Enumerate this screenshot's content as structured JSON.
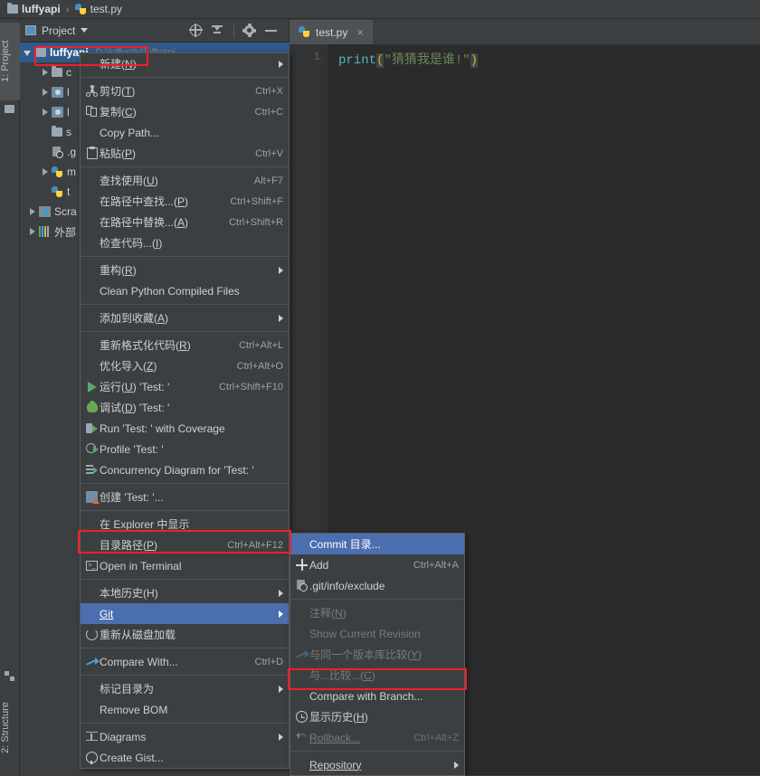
{
  "breadcrumb": {
    "project": "luffyapi",
    "separator": "›",
    "file": "test.py"
  },
  "left_strip": {
    "project_tab": "1: Project",
    "structure_tab": "2: Structure"
  },
  "project_panel": {
    "title": "Project",
    "tools": [
      "locate-icon",
      "collapse-all-icon",
      "gear-icon",
      "hide-icon"
    ],
    "tree": [
      {
        "label": "luffyapi",
        "hint": "D:\\luffycity\\luffyapi",
        "selected": true,
        "expanded": true,
        "icon": "folder-icon"
      },
      {
        "label": "c",
        "icon": "folder-icon",
        "expanded": false
      },
      {
        "label": "l",
        "icon": "module-icon",
        "expanded": false
      },
      {
        "label": "l",
        "icon": "module-icon",
        "expanded": false
      },
      {
        "label": "s",
        "icon": "folder-icon"
      },
      {
        "label": ".g",
        "icon": "gitignore-icon"
      },
      {
        "label": "m",
        "icon": "python-file-icon",
        "expanded": false
      },
      {
        "label": "t",
        "icon": "python-file-icon"
      },
      {
        "label": "Scra",
        "icon": "scratches-icon",
        "expanded": false
      },
      {
        "label": "外部",
        "icon": "libraries-icon",
        "expanded": false
      }
    ]
  },
  "editor": {
    "tab": {
      "label": "test.py",
      "close": "×",
      "icon": "python-file-icon"
    },
    "line_number": "1",
    "code": {
      "fn": "print",
      "open_paren": "(",
      "string": "\"猜猜我是谁!\"",
      "close_paren": ")"
    }
  },
  "context_menu": {
    "items": [
      {
        "label": "新建",
        "mnemonic": "N",
        "icon": "",
        "accel": "",
        "submenu": true
      },
      {
        "separator": true
      },
      {
        "label": "剪切",
        "mnemonic": "T",
        "icon": "cut-icon",
        "accel": "Ctrl+X"
      },
      {
        "label": "复制",
        "mnemonic": "C",
        "icon": "copy-icon",
        "accel": "Ctrl+C"
      },
      {
        "label": "Copy Path...",
        "icon": "",
        "accel": ""
      },
      {
        "label": "粘贴",
        "mnemonic": "P",
        "icon": "paste-icon",
        "accel": "Ctrl+V"
      },
      {
        "separator": true
      },
      {
        "label": "查找使用",
        "mnemonic": "U",
        "icon": "",
        "accel": "Alt+F7"
      },
      {
        "label": "在路径中查找...",
        "mnemonic": "P",
        "icon": "",
        "accel": "Ctrl+Shift+F"
      },
      {
        "label": "在路径中替换...",
        "mnemonic": "A",
        "icon": "",
        "accel": "Ctrl+Shift+R"
      },
      {
        "label": "检查代码...",
        "mnemonic": "I",
        "icon": "",
        "accel": ""
      },
      {
        "separator": true
      },
      {
        "label": "重构",
        "mnemonic": "R",
        "icon": "",
        "accel": "",
        "submenu": true
      },
      {
        "label": "Clean Python Compiled Files",
        "icon": "",
        "accel": ""
      },
      {
        "separator": true
      },
      {
        "label": "添加到收藏",
        "mnemonic": "A",
        "icon": "",
        "accel": "",
        "submenu": true
      },
      {
        "separator": true
      },
      {
        "label": "重新格式化代码",
        "mnemonic": "R",
        "icon": "",
        "accel": "Ctrl+Alt+L"
      },
      {
        "label": "优化导入",
        "mnemonic": "Z",
        "icon": "",
        "accel": "Ctrl+Alt+O"
      },
      {
        "label": "运行",
        "mnemonic": "U",
        "suffix": " 'Test: '",
        "icon": "run-icon",
        "accel": "Ctrl+Shift+F10"
      },
      {
        "label": "调试",
        "mnemonic": "D",
        "suffix": " 'Test: '",
        "icon": "debug-icon",
        "accel": ""
      },
      {
        "label": "Run 'Test: ' with Coverage",
        "mnemonic": "",
        "icon": "coverage-icon",
        "accel": ""
      },
      {
        "label": "Profile 'Test: '",
        "icon": "profile-icon",
        "accel": ""
      },
      {
        "label": "Concurrency Diagram for 'Test: '",
        "icon": "concurrency-icon",
        "accel": ""
      },
      {
        "separator": true
      },
      {
        "label": "创建 'Test: '...",
        "icon": "create-config-icon",
        "accel": ""
      },
      {
        "separator": true
      },
      {
        "label": "在 Explorer 中显示",
        "icon": "",
        "accel": ""
      },
      {
        "label": "目录路径",
        "mnemonic": "P",
        "icon": "",
        "accel": "Ctrl+Alt+F12"
      },
      {
        "label": "Open in Terminal",
        "icon": "terminal-icon",
        "accel": ""
      },
      {
        "separator": true
      },
      {
        "label": "本地历史",
        "mnemonic": "H",
        "icon": "",
        "accel": "",
        "submenu": true
      },
      {
        "label": "Git",
        "mnemonic": "G",
        "icon": "",
        "accel": "",
        "submenu": true,
        "selected": true,
        "highlighted_box": true
      },
      {
        "label": "重新从磁盘加载",
        "icon": "reload-icon",
        "accel": ""
      },
      {
        "separator": true
      },
      {
        "label": "Compare With...",
        "icon": "compare-icon",
        "accel": "Ctrl+D"
      },
      {
        "separator": true
      },
      {
        "label": "标记目录为",
        "icon": "",
        "accel": "",
        "submenu": true
      },
      {
        "label": "Remove BOM",
        "icon": "",
        "accel": ""
      },
      {
        "separator": true
      },
      {
        "label": "Diagrams",
        "icon": "diagrams-icon",
        "accel": "",
        "submenu": true
      },
      {
        "label": "Create Gist...",
        "icon": "github-icon",
        "accel": ""
      }
    ]
  },
  "git_submenu": {
    "items": [
      {
        "label": "Commit 目录...",
        "mnemonic": "t",
        "icon": "",
        "accel": "",
        "selected": true
      },
      {
        "label": "Add",
        "icon": "plus-icon",
        "accel": "Ctrl+Alt+A"
      },
      {
        "label": ".git/info/exclude",
        "icon": "gitignore-icon",
        "accel": ""
      },
      {
        "separator": true
      },
      {
        "label": "注释",
        "mnemonic": "N",
        "icon": "",
        "accel": "",
        "disabled": true
      },
      {
        "label": "Show Current Revision",
        "icon": "",
        "accel": "",
        "disabled": true
      },
      {
        "label": "与同一个版本库比较",
        "mnemonic": "Y",
        "icon": "compare-icon",
        "accel": "",
        "disabled": true
      },
      {
        "label": "与...比较...",
        "mnemonic": "C",
        "icon": "",
        "accel": "",
        "disabled": true
      },
      {
        "label": "Compare with Branch...",
        "icon": "",
        "accel": "",
        "highlighted_box": true
      },
      {
        "label": "显示历史",
        "mnemonic": "H",
        "icon": "history-icon",
        "accel": ""
      },
      {
        "label": "Rollback...",
        "mnemonic": "R",
        "icon": "rollback-icon",
        "accel": "Ctrl+Alt+Z",
        "disabled": true
      },
      {
        "separator": true
      },
      {
        "label": "Repository",
        "mnemonic": "R",
        "icon": "",
        "accel": "",
        "submenu": true
      }
    ]
  },
  "colors": {
    "window_bg": "#3c3f41",
    "editor_bg": "#2b2b2b",
    "menu_bg": "#3c3f41",
    "menu_border": "#5a5d5e",
    "highlight_blue": "#4b6eaf",
    "tree_select_blue": "#2f5a8a",
    "annotation_red": "#f0202a",
    "text": "#cfcfcf",
    "disabled_text": "#7a7a7a",
    "string_green": "#6a8759",
    "fn_cyan": "#56b6c2"
  }
}
